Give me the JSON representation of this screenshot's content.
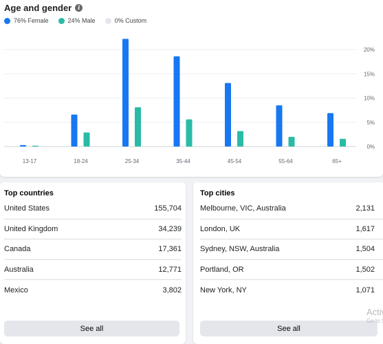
{
  "age_gender": {
    "title": "Age and gender",
    "info_icon": "info-icon",
    "legend": [
      {
        "label": "76% Female",
        "color": "#1877f2"
      },
      {
        "label": "24% Male",
        "color": "#2abba7"
      },
      {
        "label": "0% Custom",
        "color": "#e4e6eb"
      }
    ]
  },
  "chart_data": {
    "type": "bar",
    "categories": [
      "13-17",
      "18-24",
      "25-34",
      "35-44",
      "45-54",
      "55-64",
      "65+"
    ],
    "series": [
      {
        "name": "76% Female",
        "color": "#1877f2",
        "values": [
          0.3,
          6.6,
          22.2,
          18.6,
          13.1,
          8.5,
          6.9
        ]
      },
      {
        "name": "24% Male",
        "color": "#2abba7",
        "values": [
          0.1,
          2.9,
          8.1,
          5.6,
          3.2,
          2.0,
          1.6
        ]
      }
    ],
    "yticks": [
      "0%",
      "5%",
      "10%",
      "15%",
      "20%"
    ],
    "ylim": [
      0,
      24
    ],
    "grid": true,
    "legend": "top-left",
    "title": "Age and gender"
  },
  "top_countries": {
    "title": "Top countries",
    "rows": [
      {
        "name": "United States",
        "value": "155,704"
      },
      {
        "name": "United Kingdom",
        "value": "34,239"
      },
      {
        "name": "Canada",
        "value": "17,361"
      },
      {
        "name": "Australia",
        "value": "12,771"
      },
      {
        "name": "Mexico",
        "value": "3,802"
      }
    ],
    "see_all": "See all"
  },
  "top_cities": {
    "title": "Top cities",
    "rows": [
      {
        "name": "Melbourne, VIC, Australia",
        "value": "2,131"
      },
      {
        "name": "London, UK",
        "value": "1,617"
      },
      {
        "name": "Sydney, NSW, Australia",
        "value": "1,504"
      },
      {
        "name": "Portland, OR",
        "value": "1,502"
      },
      {
        "name": "New York, NY",
        "value": "1,071"
      }
    ],
    "see_all": "See all"
  },
  "watermark": {
    "line1": "Activ",
    "line2": "Go to S"
  }
}
